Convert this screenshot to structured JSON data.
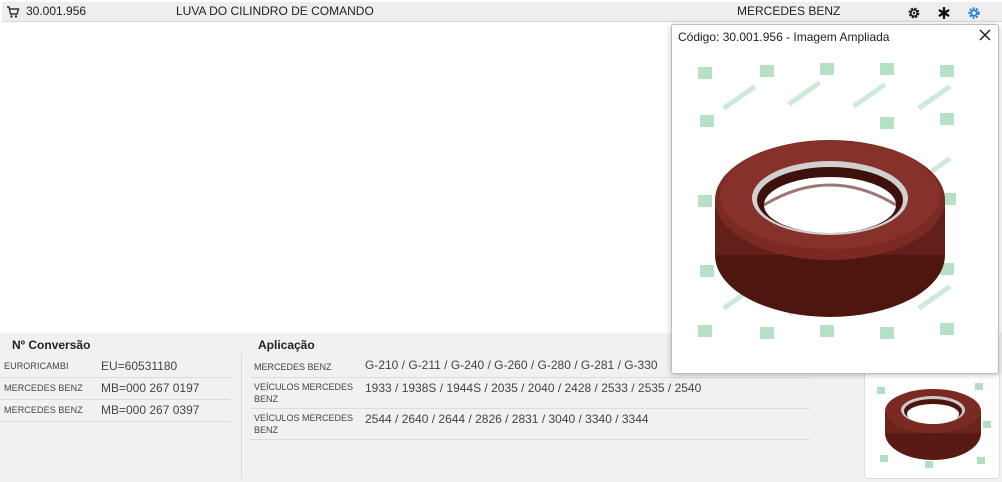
{
  "product": {
    "code": "30.001.956",
    "description": "LUVA DO CILINDRO DE COMANDO",
    "brand": "MERCEDES BENZ"
  },
  "toolbar": {
    "cart_icon": "cart-icon",
    "settings_icon": "gear-icon",
    "star_icon": "asterisk-icon",
    "link_icon": "cog-link-icon",
    "link_icon_color": "#1e7bd6"
  },
  "conversion": {
    "title": "Nº Conversão",
    "rows": [
      {
        "label": "EURORICAMBI",
        "value": "EU=60531180"
      },
      {
        "label": "MERCEDES BENZ",
        "value": "MB=000 267 0197"
      },
      {
        "label": "MERCEDES BENZ",
        "value": "MB=000 267 0397"
      }
    ]
  },
  "application": {
    "title": "Aplicação",
    "rows": [
      {
        "label": "MERCEDES BENZ",
        "value": "G-210 / G-211 / G-240 / G-260 / G-280 / G-281 / G-330"
      },
      {
        "label": "VEÍCULOS MERCEDES BENZ",
        "value": "1933 / 1938S / 1944S / 2035 / 2040 / 2428 / 2533 / 2535 / 2540"
      },
      {
        "label": "VEÍCULOS MERCEDES BENZ",
        "value": "2544 / 2640 / 2644 / 2826 / 2831 / 3040 / 3340 / 3344"
      }
    ]
  },
  "modal": {
    "title": "Código: 30.001.956 - Imagem Ampliada",
    "close_icon": "close-icon",
    "seal_color": "#7a2a22",
    "watermark_color": "#9ed8b4"
  }
}
